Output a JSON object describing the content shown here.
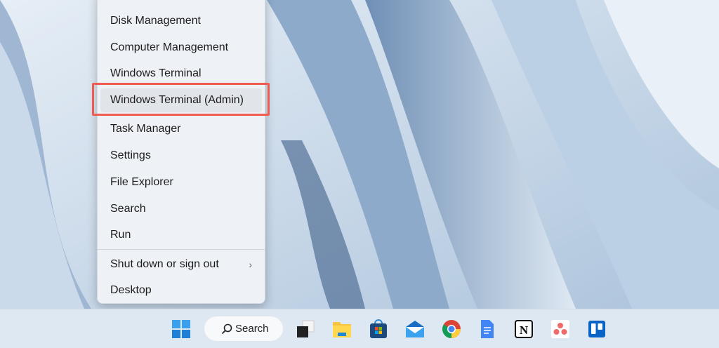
{
  "context_menu": {
    "items": [
      {
        "label": "Disk Management"
      },
      {
        "label": "Computer Management"
      },
      {
        "label": "Windows Terminal"
      },
      {
        "label": "Windows Terminal (Admin)",
        "highlighted": true
      },
      {
        "label": "Task Manager"
      },
      {
        "label": "Settings"
      },
      {
        "label": "File Explorer"
      },
      {
        "label": "Search"
      },
      {
        "label": "Run"
      },
      {
        "label": "Shut down or sign out",
        "submenu": true
      },
      {
        "label": "Desktop"
      }
    ]
  },
  "taskbar": {
    "search_label": "Search",
    "icons": [
      "windows-start-icon",
      "search-icon",
      "task-view-icon",
      "file-explorer-icon",
      "microsoft-store-icon",
      "mail-icon",
      "chrome-icon",
      "google-docs-icon",
      "notion-icon",
      "asana-icon",
      "trello-icon"
    ]
  },
  "colors": {
    "highlight_box": "#ef5b50",
    "taskbar": "#dde8f2"
  }
}
